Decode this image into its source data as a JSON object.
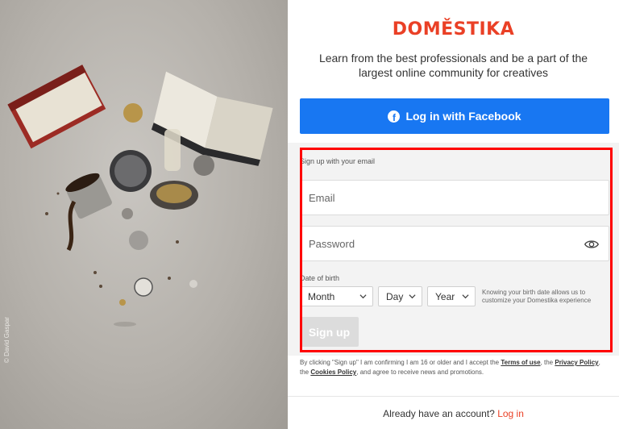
{
  "hero": {
    "credit": "© David Gaspar"
  },
  "brand": {
    "logo": "DOMĚSTIKA",
    "tagline": "Learn from the best professionals and be a part of the largest online community for creatives",
    "accent": "#ea4026"
  },
  "facebook": {
    "label": "Log in with Facebook",
    "color": "#1877f2",
    "icon": "facebook-icon"
  },
  "signup": {
    "heading": "Sign up with your email",
    "email_placeholder": "Email",
    "password_placeholder": "Password",
    "password_icon": "eye-icon",
    "dob_label": "Date of birth",
    "month": "Month",
    "day": "Day",
    "year": "Year",
    "dob_help": "Knowing your birth date allows us to customize your Domestika experience",
    "button": "Sign up"
  },
  "legal": {
    "p1": "By clicking \"Sign up\" I am confirming I am 16 or older and I accept the ",
    "terms": "Terms of use",
    "p2": ", the ",
    "privacy": "Privacy Policy",
    "p3": ", the ",
    "cookies": "Cookies Policy",
    "p4": ", and agree to receive news and promotions."
  },
  "footer": {
    "text": "Already have an account?",
    "login": "Log in"
  }
}
